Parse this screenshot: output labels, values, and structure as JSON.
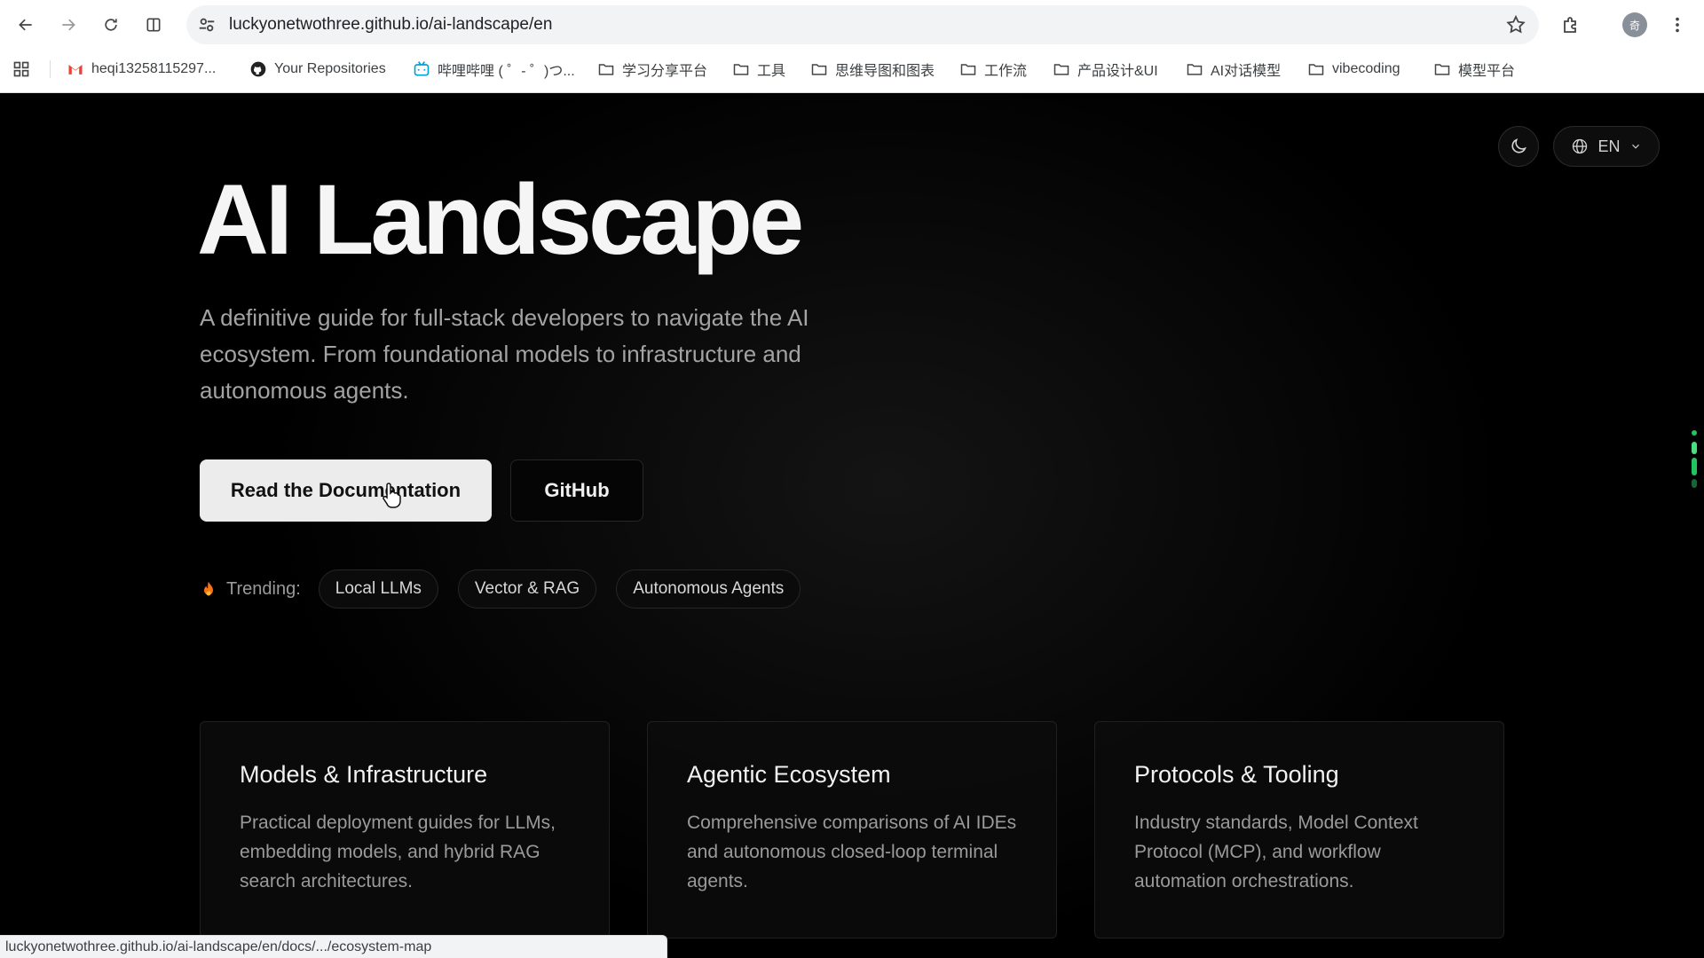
{
  "browser": {
    "url": "luckyonetwothree.github.io/ai-landscape/en",
    "bookmarks": [
      {
        "label": "heqi13258115297...",
        "icon": "gmail-icon"
      },
      {
        "label": "Your Repositories",
        "icon": "github-icon"
      },
      {
        "label": "哔哩哔哩 ( ゜- ゜)つ...",
        "icon": "bilibili-icon"
      },
      {
        "label": "学习分享平台",
        "icon": "folder-icon"
      },
      {
        "label": "工具",
        "icon": "folder-icon"
      },
      {
        "label": "思维导图和图表",
        "icon": "folder-icon"
      },
      {
        "label": "工作流",
        "icon": "folder-icon"
      },
      {
        "label": "产品设计&UI",
        "icon": "folder-icon"
      },
      {
        "label": "AI对话模型",
        "icon": "folder-icon"
      },
      {
        "label": "vibecoding",
        "icon": "folder-icon"
      },
      {
        "label": "模型平台",
        "icon": "folder-icon"
      }
    ],
    "avatar_text": "奇",
    "status_url": "luckyonetwothree.github.io/ai-landscape/en/docs/.../ecosystem-map"
  },
  "header": {
    "lang_label": "EN"
  },
  "hero": {
    "title": "AI Landscape",
    "subtitle": "A definitive guide for full-stack developers to navigate the AI ecosystem. From foundational models to infrastructure and autonomous agents.",
    "primary_button": "Read the Documentation",
    "secondary_button": "GitHub"
  },
  "trending": {
    "label": "Trending:",
    "chips": [
      "Local LLMs",
      "Vector & RAG",
      "Autonomous Agents"
    ]
  },
  "cards": [
    {
      "title": "Models & Infrastructure",
      "text": "Practical deployment guides for LLMs, embedding models, and hybrid RAG search architectures."
    },
    {
      "title": "Agentic Ecosystem",
      "text": "Comprehensive comparisons of AI IDEs and autonomous closed-loop terminal agents."
    },
    {
      "title": "Protocols & Tooling",
      "text": "Industry standards, Model Context Protocol (MCP), and workflow automation orchestrations."
    }
  ],
  "colors": {
    "page_bg": "#000000",
    "primary_button_bg": "#ececec",
    "trending_flame": "#f97316",
    "scroll_indicator": "#22c55e"
  }
}
